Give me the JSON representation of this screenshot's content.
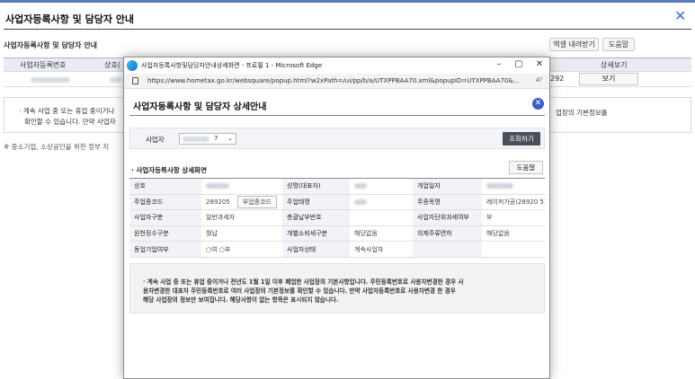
{
  "page": {
    "title": "사업자등록사항 및 담당자 안내",
    "close_icon": "close-icon",
    "sub_title": "사업자등록사항 및 담당자 안내",
    "excel_btn": "엑셀 내려받기",
    "help_btn": "도움말",
    "grid_headers": [
      "사업자등록번호",
      "상호(",
      "",
      "상세보기"
    ],
    "grid_row": {
      "tail_value": "292",
      "view_btn": "보기"
    },
    "notice_lines": [
      "· 계속 사업 중 또는 휴업 중이거나",
      "확인할 수 있습니다. 만약 사업자"
    ],
    "notice_right": "업장의 기본정보를",
    "footnote": "※ 중소기업, 소상공인을 위한 정부 지"
  },
  "popup": {
    "window_title": "사업자등록사항및담당자안내상세화면 - 프로필 1 - Microsoft Edge",
    "controls": [
      "–",
      "▢",
      "✕"
    ],
    "url": "https://www.hometax.go.kr/websquare/popup.html?w2xPath=/ui/pp/b/a/UTXPPBAA70.xml&popupID=UTXPPBAA70&...",
    "aa": "Aʰ",
    "title": "사업자등록사항 및 담당자 상세안내",
    "search": {
      "label": "사업자",
      "selected_suffix": "7",
      "query_btn": "조회하기"
    },
    "section": "· 사업자등록사항 상세화면",
    "help_btn": "도움말",
    "rows": [
      [
        {
          "k": "상호"
        },
        {
          "v": "",
          "blur": true
        },
        {
          "k": "성명(대표자)"
        },
        {
          "v": "",
          "blur": true
        },
        {
          "k": "개업일자"
        },
        {
          "v": "",
          "blur": true
        }
      ],
      [
        {
          "k": "주업종코드"
        },
        {
          "v": "289205",
          "btn": "부업종코드"
        },
        {
          "k": "주업태명"
        },
        {
          "v": "",
          "blur": true
        },
        {
          "k": "주종목명"
        },
        {
          "v": "레이저가공(28920 5)"
        }
      ],
      [
        {
          "k": "사업자구분"
        },
        {
          "v": "일반과세자"
        },
        {
          "k": "총괄납부번호"
        },
        {
          "v": ""
        },
        {
          "k": "사업자단위과세여부"
        },
        {
          "v": "부"
        }
      ],
      [
        {
          "k": "원천징수구분"
        },
        {
          "v": "월납"
        },
        {
          "k": "개별소비세구분"
        },
        {
          "v": "해당없음"
        },
        {
          "k": "의제주류면허"
        },
        {
          "v": "해당없음"
        }
      ],
      [
        {
          "k": "동업기업여부"
        },
        {
          "v": "○여 ○부"
        },
        {
          "k": "사업자상태"
        },
        {
          "v": "계속사업자"
        },
        {
          "k": ""
        },
        {
          "v": ""
        }
      ]
    ],
    "notice": [
      "· 계속 사업 중 또는 휴업 중이거나 전년도 1월 1일 이후 폐업한 사업장의 기본사항입니다. 주민등록번호로 사용자변경한 경우 사",
      "  용자변경한 대표자 주민등록번호로 여러 사업장의 기본정보를 확인할 수 있습니다. 만약 사업자등록번호로 사용자변경 한 경우",
      "  해당 사업장의 정보만 보여집니다. 해당사항이 없는 항목은 표시되지 않습니다."
    ]
  }
}
